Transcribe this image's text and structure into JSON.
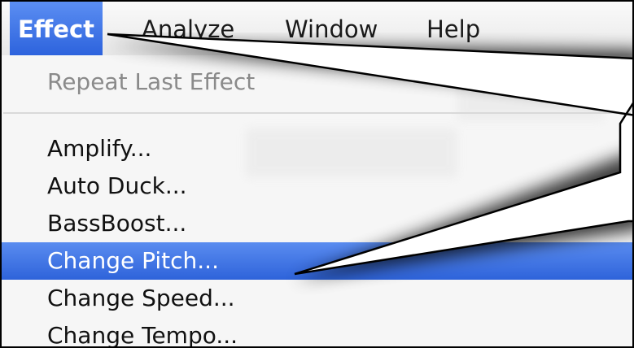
{
  "menubar": {
    "titles": [
      {
        "label": "Effect"
      },
      {
        "label": "Analyze"
      },
      {
        "label": "Window"
      },
      {
        "label": "Help"
      }
    ]
  },
  "menu": {
    "items": [
      {
        "label": "Repeat Last Effect",
        "enabled": false
      },
      {
        "label": "Amplify..."
      },
      {
        "label": "Auto Duck..."
      },
      {
        "label": "BassBoost..."
      },
      {
        "label": "Change Pitch...",
        "selected": true
      },
      {
        "label": "Change Speed..."
      },
      {
        "label": "Change Tempo..."
      }
    ]
  },
  "colors": {
    "highlight": "#2e63da",
    "callout_fill": "#ffffff",
    "callout_stroke": "#000000"
  }
}
